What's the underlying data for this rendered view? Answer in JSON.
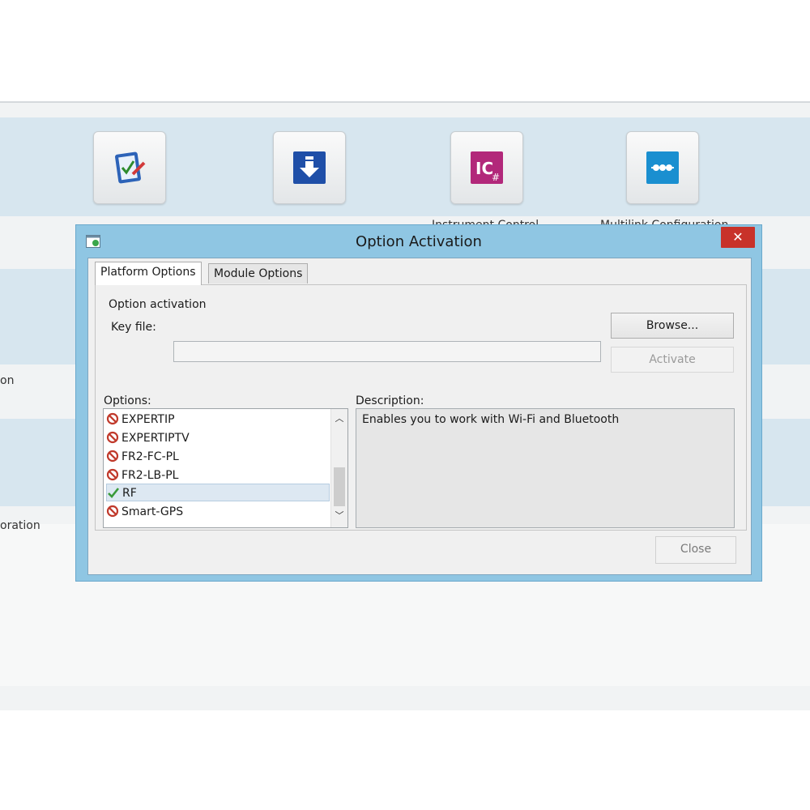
{
  "background_app": {
    "side_labels": [
      "on",
      "oration"
    ],
    "tiles": [
      {
        "icon": "checklist-pen-icon",
        "label": ""
      },
      {
        "icon": "download-arrow-icon",
        "label": ""
      },
      {
        "icon": "ic-sharp-icon",
        "label": "Instrument Control"
      },
      {
        "icon": "multilink-icon",
        "label": "Multilink Configuration"
      }
    ]
  },
  "dialog": {
    "title": "Option Activation",
    "close_symbol": "✕",
    "tabs": [
      "Platform Options",
      "Module Options"
    ],
    "section_label": "Option activation",
    "keyfile_label": "Key file:",
    "keyfile_value": "",
    "browse_label": "Browse...",
    "activate_label": "Activate",
    "options_label": "Options:",
    "description_label": "Description:",
    "options": [
      {
        "name": "EXPERTIP",
        "status": "disabled"
      },
      {
        "name": "EXPERTIPTV",
        "status": "disabled"
      },
      {
        "name": "FR2-FC-PL",
        "status": "disabled"
      },
      {
        "name": "FR2-LB-PL",
        "status": "disabled"
      },
      {
        "name": "RF",
        "status": "enabled",
        "selected": true
      },
      {
        "name": "Smart-GPS",
        "status": "disabled"
      }
    ],
    "description_text": "Enables you to work with Wi-Fi and Bluetooth",
    "close_label": "Close"
  },
  "colors": {
    "dialog_frame": "#8fc6e3",
    "close_red": "#c8322a",
    "disabled_icon": "#c0392b",
    "enabled_check": "#3a9a3a"
  }
}
